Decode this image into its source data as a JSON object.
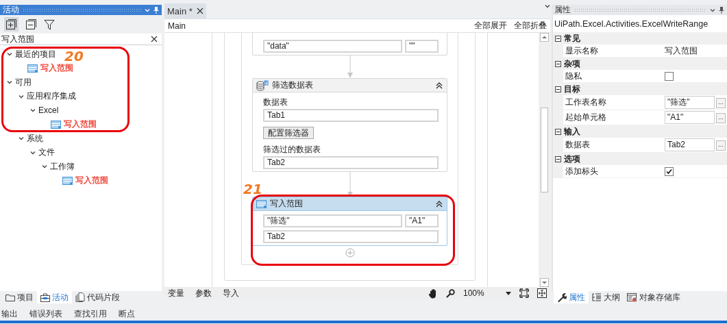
{
  "activities_panel": {
    "title": "活动",
    "search": {
      "value": "写入范围"
    },
    "tree": [
      {
        "label": "最近的项目",
        "kind": "group",
        "expanded": true,
        "match": false,
        "children": [
          {
            "label": "写入范围",
            "kind": "activity",
            "match": true
          }
        ]
      },
      {
        "label": "可用",
        "kind": "group",
        "expanded": true,
        "match": false,
        "children": [
          {
            "label": "应用程序集成",
            "kind": "group",
            "expanded": true,
            "match": false,
            "children": [
              {
                "label": "Excel",
                "kind": "group",
                "expanded": true,
                "match": false,
                "children": [
                  {
                    "label": "写入范围",
                    "kind": "activity",
                    "match": true
                  }
                ]
              }
            ]
          },
          {
            "label": "系统",
            "kind": "group",
            "expanded": true,
            "match": false,
            "children": [
              {
                "label": "文件",
                "kind": "group",
                "expanded": true,
                "match": false,
                "children": [
                  {
                    "label": "工作簿",
                    "kind": "group",
                    "expanded": true,
                    "match": false,
                    "children": [
                      {
                        "label": "写入范围",
                        "kind": "activity",
                        "match": true
                      }
                    ]
                  }
                ]
              }
            ]
          }
        ]
      }
    ],
    "tabs": [
      {
        "label": "项目",
        "kind": "project",
        "selected": false
      },
      {
        "label": "活动",
        "kind": "activities",
        "selected": true
      },
      {
        "label": "代码片段",
        "kind": "snippets",
        "selected": false
      }
    ]
  },
  "designer": {
    "tabs": [
      {
        "label": "Main *",
        "selected": true
      }
    ],
    "breadcrumb": "Main",
    "actions": [
      "全部展开",
      "全部折叠"
    ],
    "activities": [
      {
        "kind": "clipped",
        "selected": false,
        "rows": [
          {
            "kind": "fields",
            "fields": [
              "\"data\"",
              "\"\""
            ]
          }
        ]
      },
      {
        "kind": "filter",
        "title": "筛选数据表",
        "selected": false,
        "rows": [
          {
            "kind": "label",
            "text": "数据表"
          },
          {
            "kind": "fields",
            "fields": [
              "Tab1"
            ]
          },
          {
            "kind": "button",
            "text": "配置筛选器"
          },
          {
            "kind": "label",
            "text": "筛选过的数据表"
          },
          {
            "kind": "fields",
            "fields": [
              "Tab2"
            ]
          }
        ]
      },
      {
        "kind": "write",
        "title": "写入范围",
        "selected": true,
        "rows": [
          {
            "kind": "fields",
            "fields": [
              "\"筛选\"",
              "\"A1\""
            ]
          },
          {
            "kind": "fields",
            "fields": [
              "Tab2"
            ]
          }
        ]
      }
    ],
    "toolbar": {
      "tabs": [
        "变量",
        "参数",
        "导入"
      ],
      "zoom": "100%"
    }
  },
  "properties": {
    "title": "属性",
    "type_name": "UiPath.Excel.Activities.ExcelWriteRange",
    "categories": [
      {
        "name": "常见",
        "expanded": true,
        "props": [
          {
            "name": "显示名称",
            "kind": "text",
            "value": "写入范围"
          }
        ]
      },
      {
        "name": "杂项",
        "expanded": true,
        "props": [
          {
            "name": "隐私",
            "kind": "checkbox",
            "checked": false
          }
        ]
      },
      {
        "name": "目标",
        "expanded": true,
        "props": [
          {
            "name": "工作表名称",
            "kind": "field",
            "value": "\"筛选\"",
            "button": "..."
          },
          {
            "name": "起始单元格",
            "kind": "field",
            "value": "\"A1\"",
            "button": "..."
          }
        ]
      },
      {
        "name": "输入",
        "expanded": true,
        "props": [
          {
            "name": "数据表",
            "kind": "field",
            "value": "Tab2",
            "button": "..."
          }
        ]
      },
      {
        "name": "选项",
        "expanded": true,
        "props": [
          {
            "name": "添加标头",
            "kind": "checkbox",
            "checked": true
          }
        ]
      }
    ],
    "tabs": [
      {
        "label": "属性",
        "kind": "properties",
        "selected": true
      },
      {
        "label": "大纲",
        "kind": "outline",
        "selected": false
      },
      {
        "label": "对象存储库",
        "kind": "repository",
        "selected": false
      }
    ]
  },
  "output_tabs": [
    "输出",
    "错误列表",
    "查找引用",
    "断点"
  ],
  "annotations": [
    {
      "label": "20"
    },
    {
      "label": "21"
    }
  ]
}
